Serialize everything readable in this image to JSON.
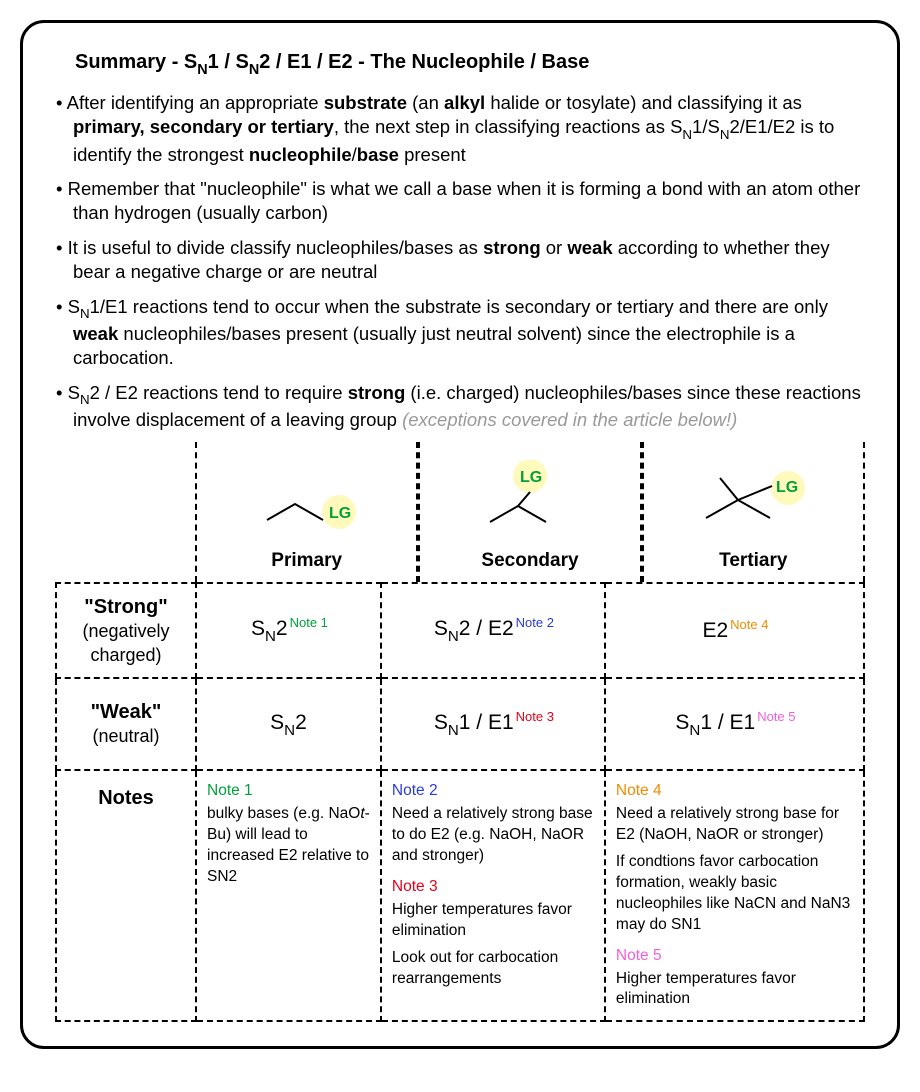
{
  "title_parts": {
    "prefix": "Summary - S",
    "mid1": "1 / S",
    "mid2": "2 / E1 / E2 - The Nucleophile / Base"
  },
  "bullets": [
    {
      "frags": [
        {
          "t": "After identifying an appropriate "
        },
        {
          "t": "substrate",
          "b": true
        },
        {
          "t": " (an "
        },
        {
          "t": "alkyl",
          "b": true
        },
        {
          "t": " halide or tosylate) and classifying it as "
        },
        {
          "t": "primary, secondary or tertiary",
          "b": true
        },
        {
          "t": ", the next step in classifying reactions as S"
        },
        {
          "t": "N",
          "sub": true
        },
        {
          "t": "1/S"
        },
        {
          "t": "N",
          "sub": true
        },
        {
          "t": "2/E1/E2  is to identify the strongest "
        },
        {
          "t": "nucleophile",
          "b": true
        },
        {
          "t": "/"
        },
        {
          "t": "base",
          "b": true
        },
        {
          "t": " present"
        }
      ]
    },
    {
      "frags": [
        {
          "t": "Remember that \"nucleophile\" is what we call a base when it is forming a bond with an atom other than hydrogen (usually carbon)"
        }
      ]
    },
    {
      "frags": [
        {
          "t": "It is useful to divide classify nucleophiles/bases as "
        },
        {
          "t": "strong",
          "b": true
        },
        {
          "t": " or "
        },
        {
          "t": "weak",
          "b": true
        },
        {
          "t": " according to whether they bear a negative charge or are neutral"
        }
      ]
    },
    {
      "frags": [
        {
          "t": "S"
        },
        {
          "t": "N",
          "sub": true
        },
        {
          "t": "1/E1 reactions tend to occur when the substrate is secondary or tertiary and there are only "
        },
        {
          "t": "weak",
          "b": true
        },
        {
          "t": " nucleophiles/bases present (usually just neutral solvent) since the electrophile is a carbocation."
        }
      ]
    },
    {
      "frags": [
        {
          "t": "S"
        },
        {
          "t": "N",
          "sub": true
        },
        {
          "t": "2 / E2 reactions tend to require "
        },
        {
          "t": "strong",
          "b": true
        },
        {
          "t": " (i.e. charged) nucleophiles/bases since these reactions involve displacement of a leaving group "
        },
        {
          "t": "(exceptions covered in the article below!)",
          "grey": true
        }
      ]
    }
  ],
  "columns": {
    "primary": "Primary",
    "secondary": "Secondary",
    "tertiary": "Tertiary",
    "lg": "LG"
  },
  "rows": {
    "strong": {
      "head": "\"Strong\"",
      "sub": "(negatively charged)"
    },
    "weak": {
      "head": "\"Weak\"",
      "sub": "(neutral)"
    },
    "notes": "Notes"
  },
  "grid": {
    "strong_primary": {
      "main": "S",
      "sub": "N",
      "after": "2",
      "note": "Note 1",
      "color": "c-green"
    },
    "strong_secondary": {
      "main": "S",
      "sub": "N",
      "after": "2 / E2",
      "note": "Note 2",
      "color": "c-blue"
    },
    "strong_tertiary": {
      "main": "E2",
      "note": "Note 4",
      "color": "c-orange"
    },
    "weak_primary": {
      "main": "S",
      "sub": "N",
      "after": "2"
    },
    "weak_secondary": {
      "main": "S",
      "sub": "N",
      "after": "1 / E1",
      "note": "Note 3",
      "color": "c-red"
    },
    "weak_tertiary": {
      "main": "S",
      "sub": "N",
      "after": "1 / E1",
      "note": "Note 5",
      "color": "c-pink"
    }
  },
  "notes": {
    "n1": {
      "label": "Note 1",
      "color": "c-green",
      "text_pre": "bulky bases (e.g. NaO",
      "text_ital": "t",
      "text_post": "-Bu) will lead to increased E2 relative to SN2"
    },
    "n2": {
      "label": "Note 2",
      "color": "c-blue",
      "text": "Need a relatively strong base to do E2 (e.g. NaOH, NaOR and stronger)"
    },
    "n3": {
      "label": "Note 3",
      "color": "c-red",
      "text": "Higher temperatures favor elimination",
      "text2": "Look out for carbocation rearrangements"
    },
    "n4": {
      "label": "Note 4",
      "color": "c-orange",
      "text": "Need a relatively strong base for E2 (NaOH, NaOR or stronger)",
      "text2": "If condtions favor carbocation formation, weakly basic nucleophiles like NaCN and NaN3 may do SN1"
    },
    "n5": {
      "label": "Note 5",
      "color": "c-pink",
      "text": "Higher temperatures favor elimination"
    }
  }
}
